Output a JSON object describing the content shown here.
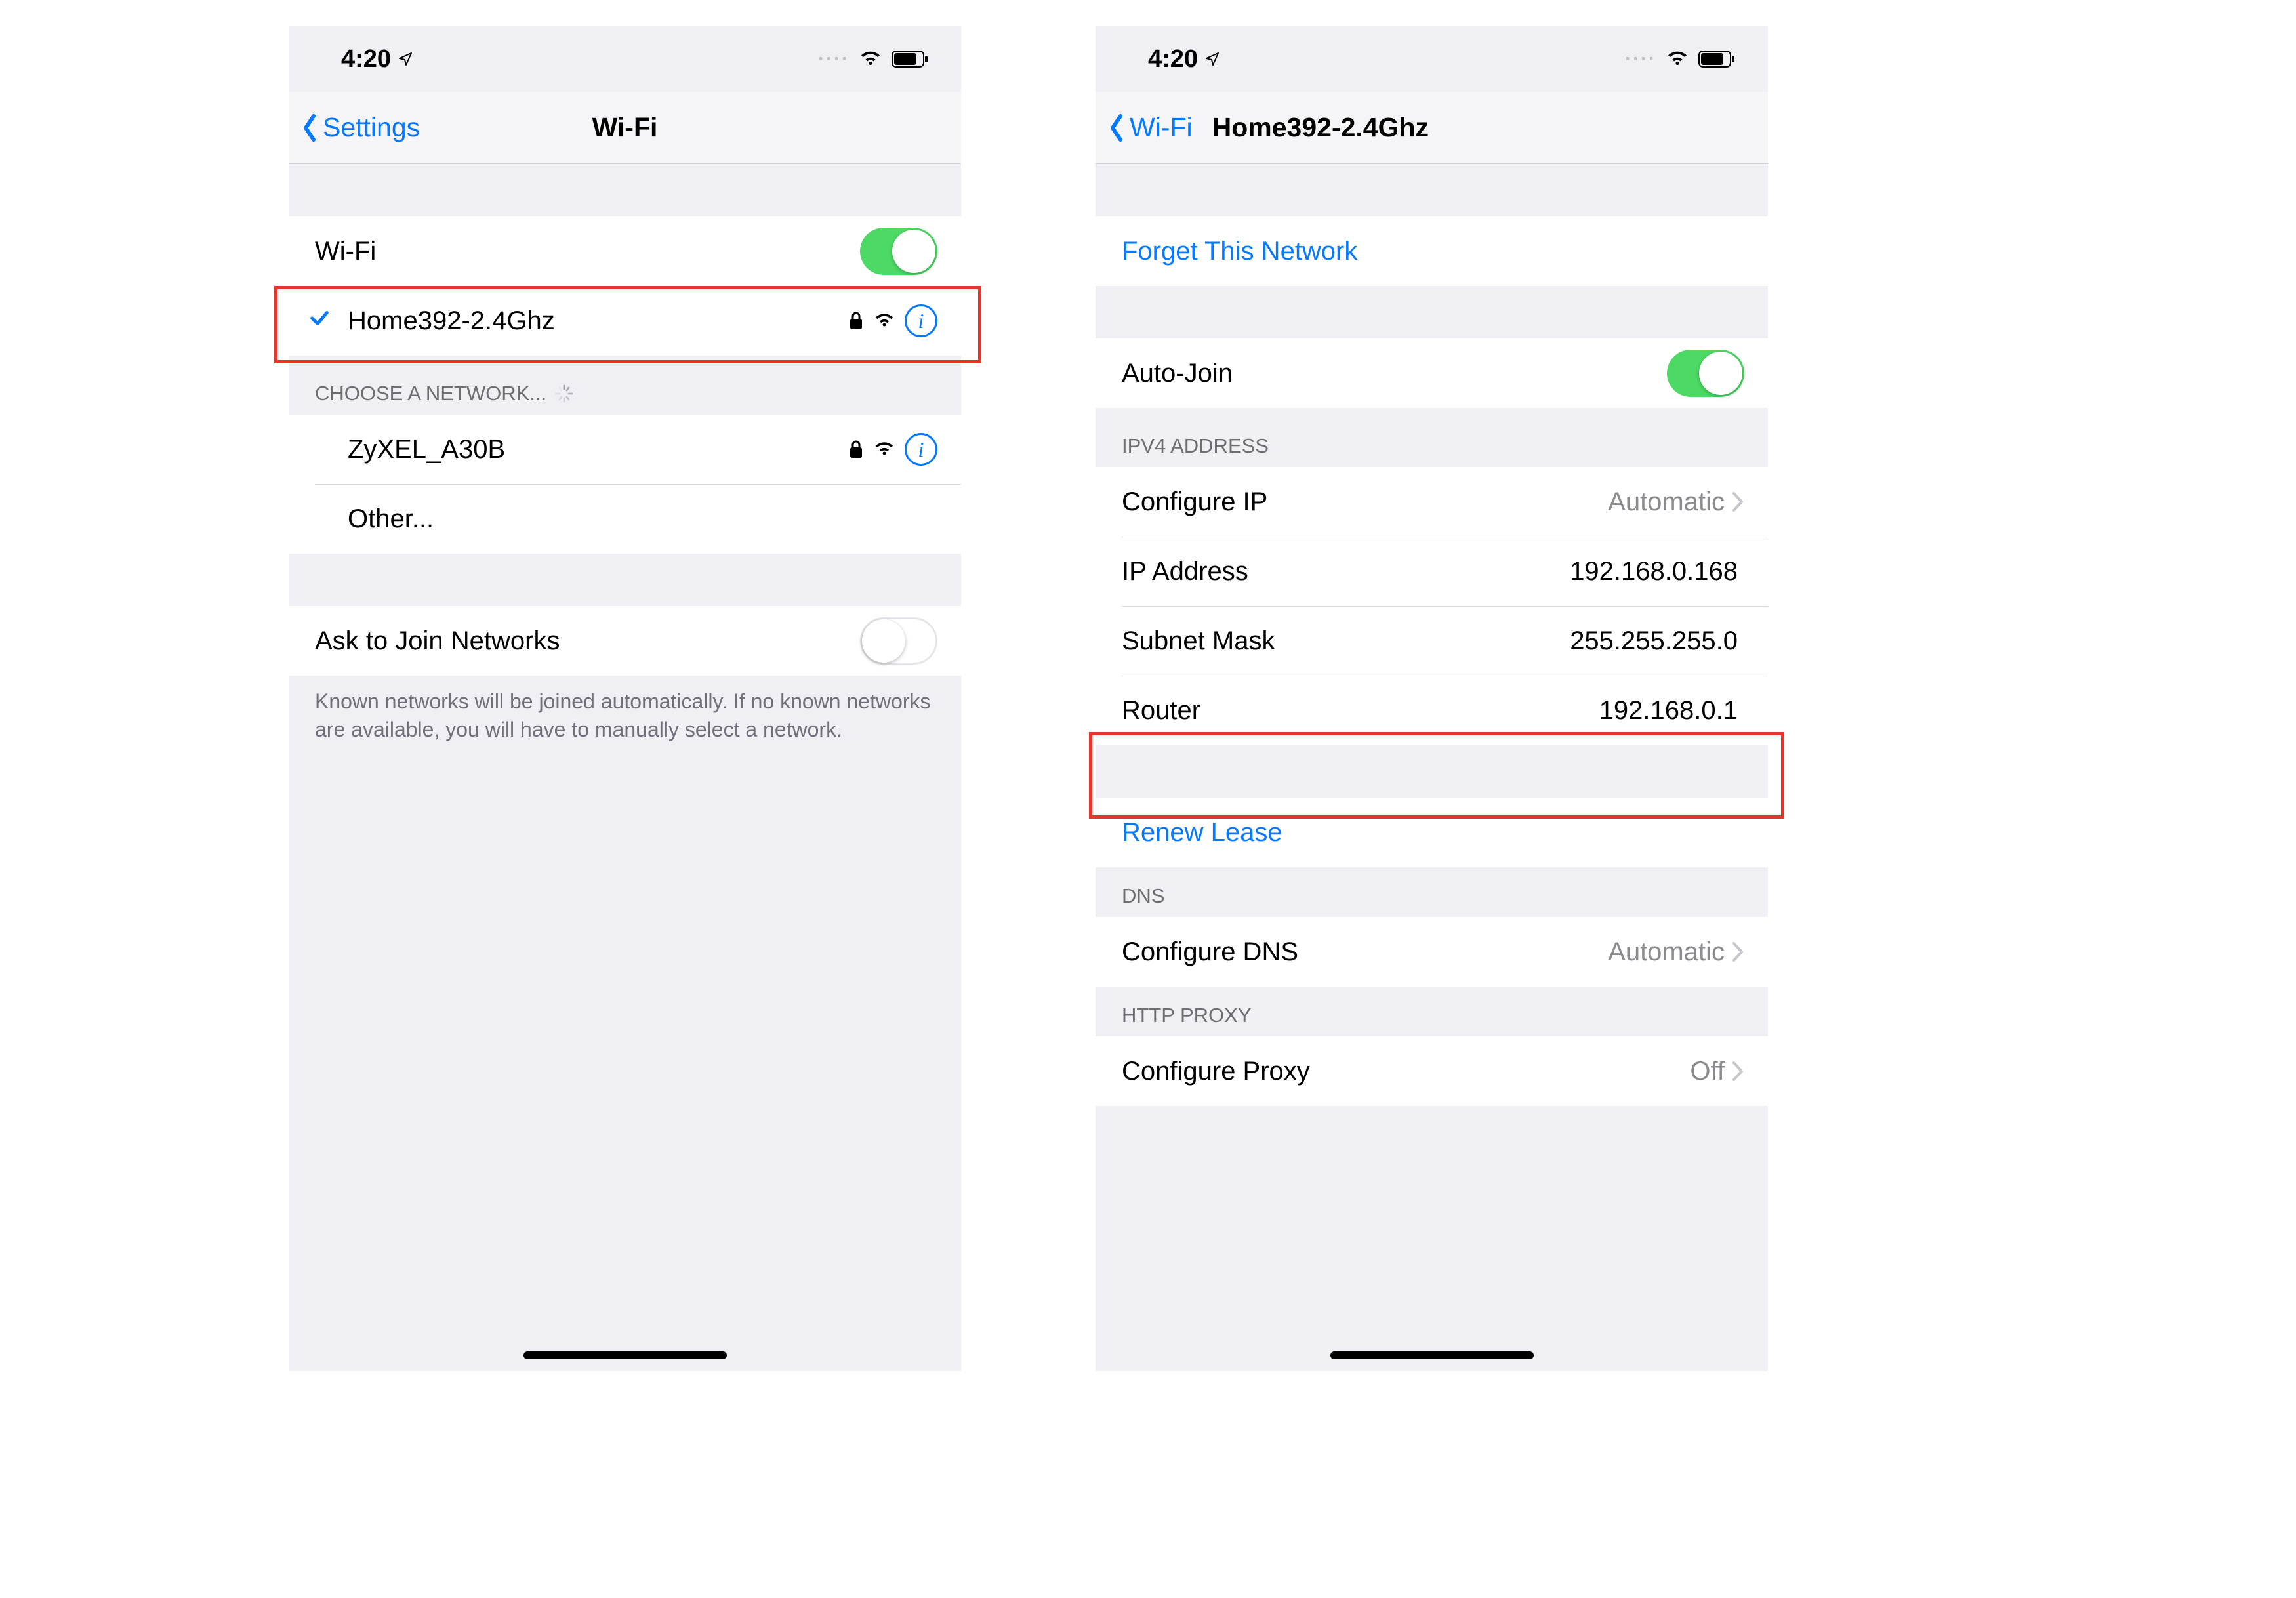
{
  "status": {
    "time": "4:20",
    "dots": "····"
  },
  "colors": {
    "accent": "#0679ff",
    "toggleOn": "#4cd964",
    "highlight": "#e5352d"
  },
  "left": {
    "back": "Settings",
    "title": "Wi-Fi",
    "wifiRow": {
      "label": "Wi-Fi",
      "on": true
    },
    "connected": {
      "name": "Home392-2.4Ghz"
    },
    "chooseHeader": "CHOOSE A NETWORK...",
    "networks": [
      {
        "name": "ZyXEL_A30B",
        "secure": true
      }
    ],
    "otherLabel": "Other...",
    "askJoin": {
      "label": "Ask to Join Networks",
      "on": false
    },
    "footer": "Known networks will be joined automatically. If no known networks are available, you will have to manually select a network."
  },
  "right": {
    "back": "Wi-Fi",
    "title": "Home392-2.4Ghz",
    "forget": "Forget This Network",
    "autoJoin": {
      "label": "Auto-Join",
      "on": true
    },
    "ipv4Header": "IPV4 ADDRESS",
    "rows": {
      "configureIp": {
        "label": "Configure IP",
        "value": "Automatic",
        "chevron": true
      },
      "ipAddress": {
        "label": "IP Address",
        "value": "192.168.0.168"
      },
      "subnet": {
        "label": "Subnet Mask",
        "value": "255.255.255.0"
      },
      "router": {
        "label": "Router",
        "value": "192.168.0.1"
      }
    },
    "renew": "Renew Lease",
    "dnsHeader": "DNS",
    "configureDns": {
      "label": "Configure DNS",
      "value": "Automatic",
      "chevron": true
    },
    "proxyHeader": "HTTP PROXY",
    "configureProxy": {
      "label": "Configure Proxy",
      "value": "Off",
      "chevron": true
    }
  }
}
